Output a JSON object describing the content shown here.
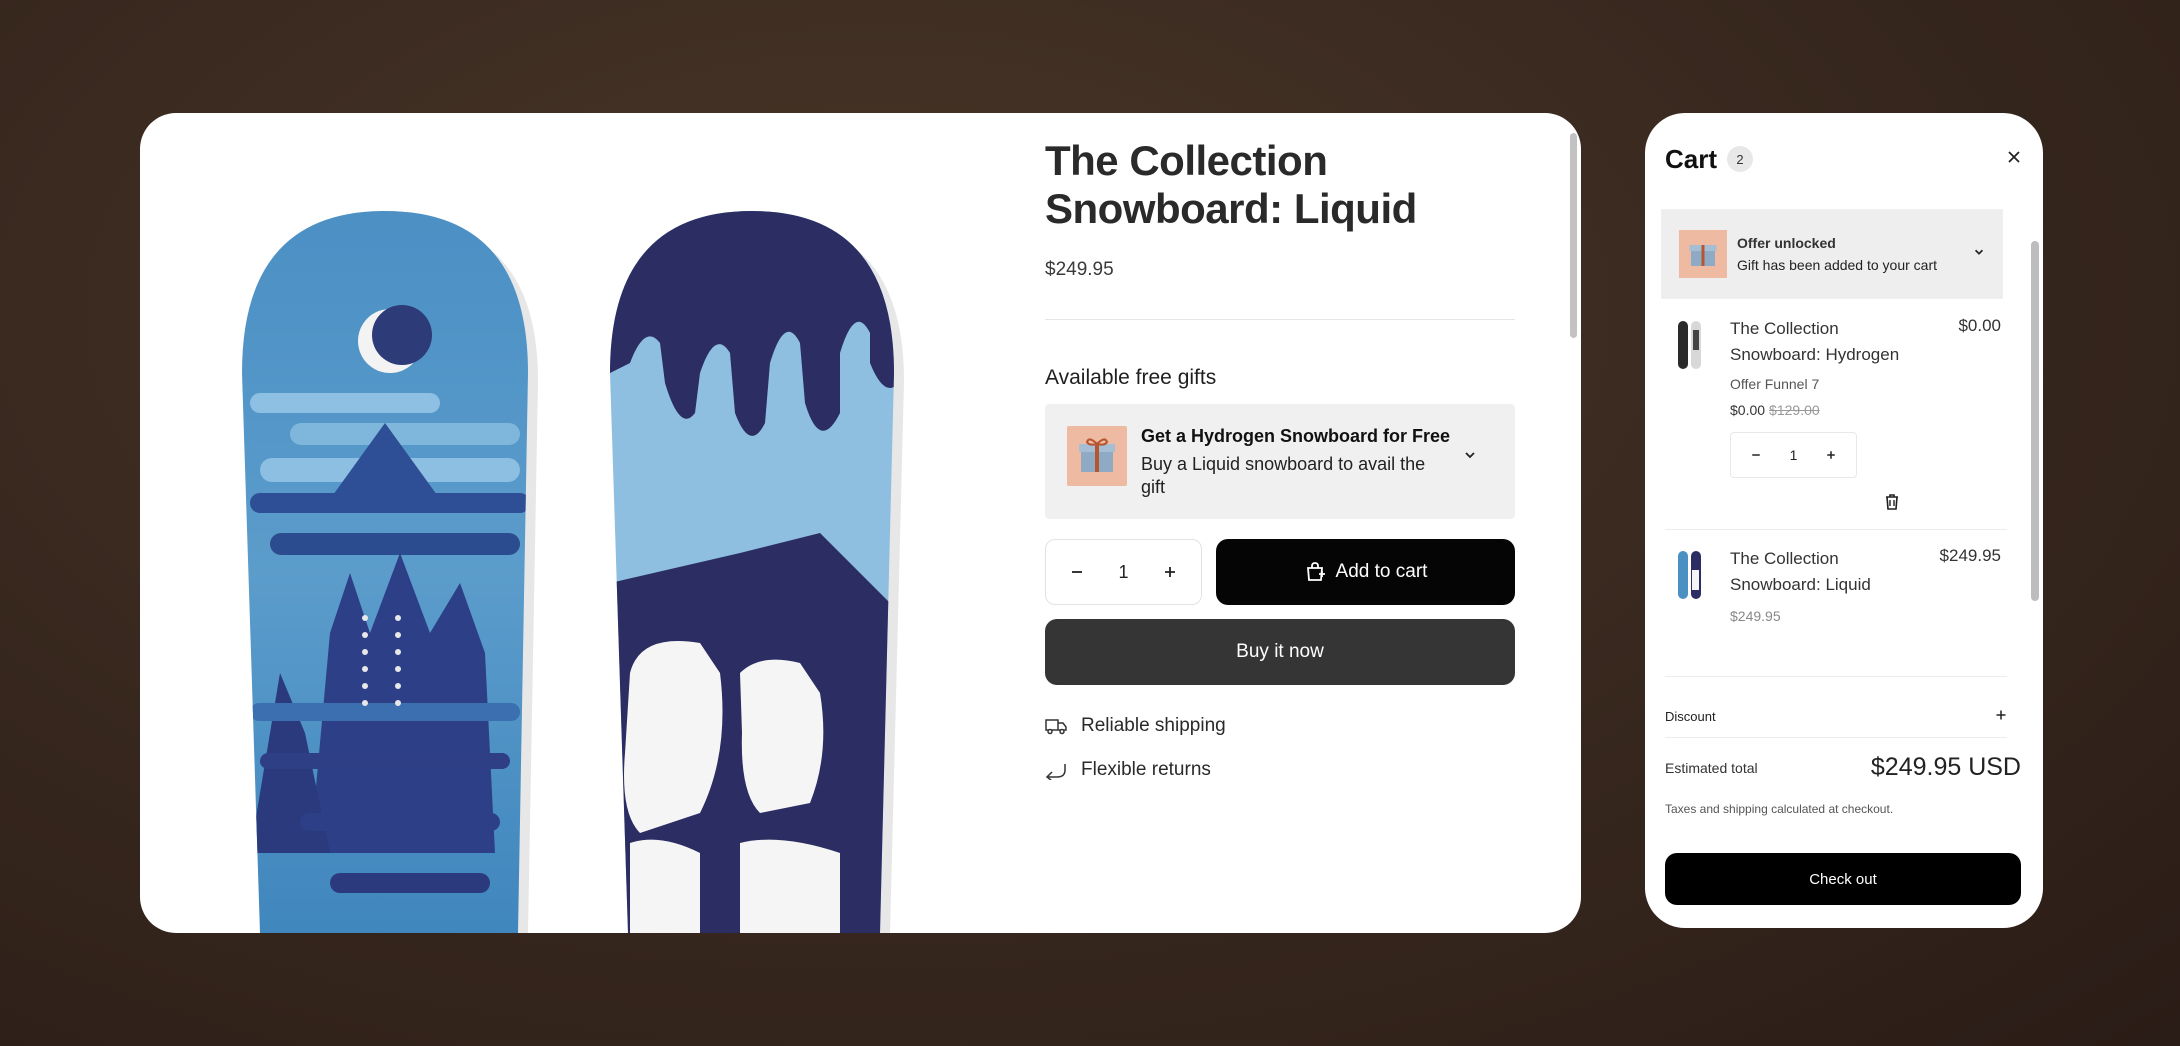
{
  "product": {
    "title_line1": "The Collection",
    "title_line2": "Snowboard: Liquid",
    "price": "$249.95",
    "gifts_heading": "Available free gifts",
    "gift": {
      "title": "Get a Hydrogen Snowboard for Free",
      "subtitle": "Buy a Liquid snowboard to avail the gift"
    },
    "quantity": "1",
    "add_to_cart_label": "Add to cart",
    "buy_now_label": "Buy it now",
    "features": [
      "Reliable shipping",
      "Flexible returns"
    ]
  },
  "cart": {
    "title": "Cart",
    "count": "2",
    "offer": {
      "title": "Offer unlocked",
      "subtitle": "Gift has been added to your cart"
    },
    "items": [
      {
        "name": "The Collection Snowboard: Hydrogen",
        "meta": "Offer Funnel 7",
        "price": "$0.00",
        "compare_price": "$129.00",
        "quantity": "1",
        "line_total": "$0.00"
      },
      {
        "name": "The Collection Snowboard: Liquid",
        "price": "$249.95",
        "line_total": "$249.95"
      }
    ],
    "discount_label": "Discount",
    "estimated_total_label": "Estimated total",
    "estimated_total": "$249.95 USD",
    "tax_note": "Taxes and shipping calculated at checkout.",
    "checkout_label": "Check out"
  },
  "colors": {
    "background": "#3a2a20",
    "primary_button": "#050505",
    "secondary_button": "#353535",
    "gift_thumb": "#eebba2",
    "board_blue": "#4a90c2",
    "board_navy": "#2b2d63"
  }
}
